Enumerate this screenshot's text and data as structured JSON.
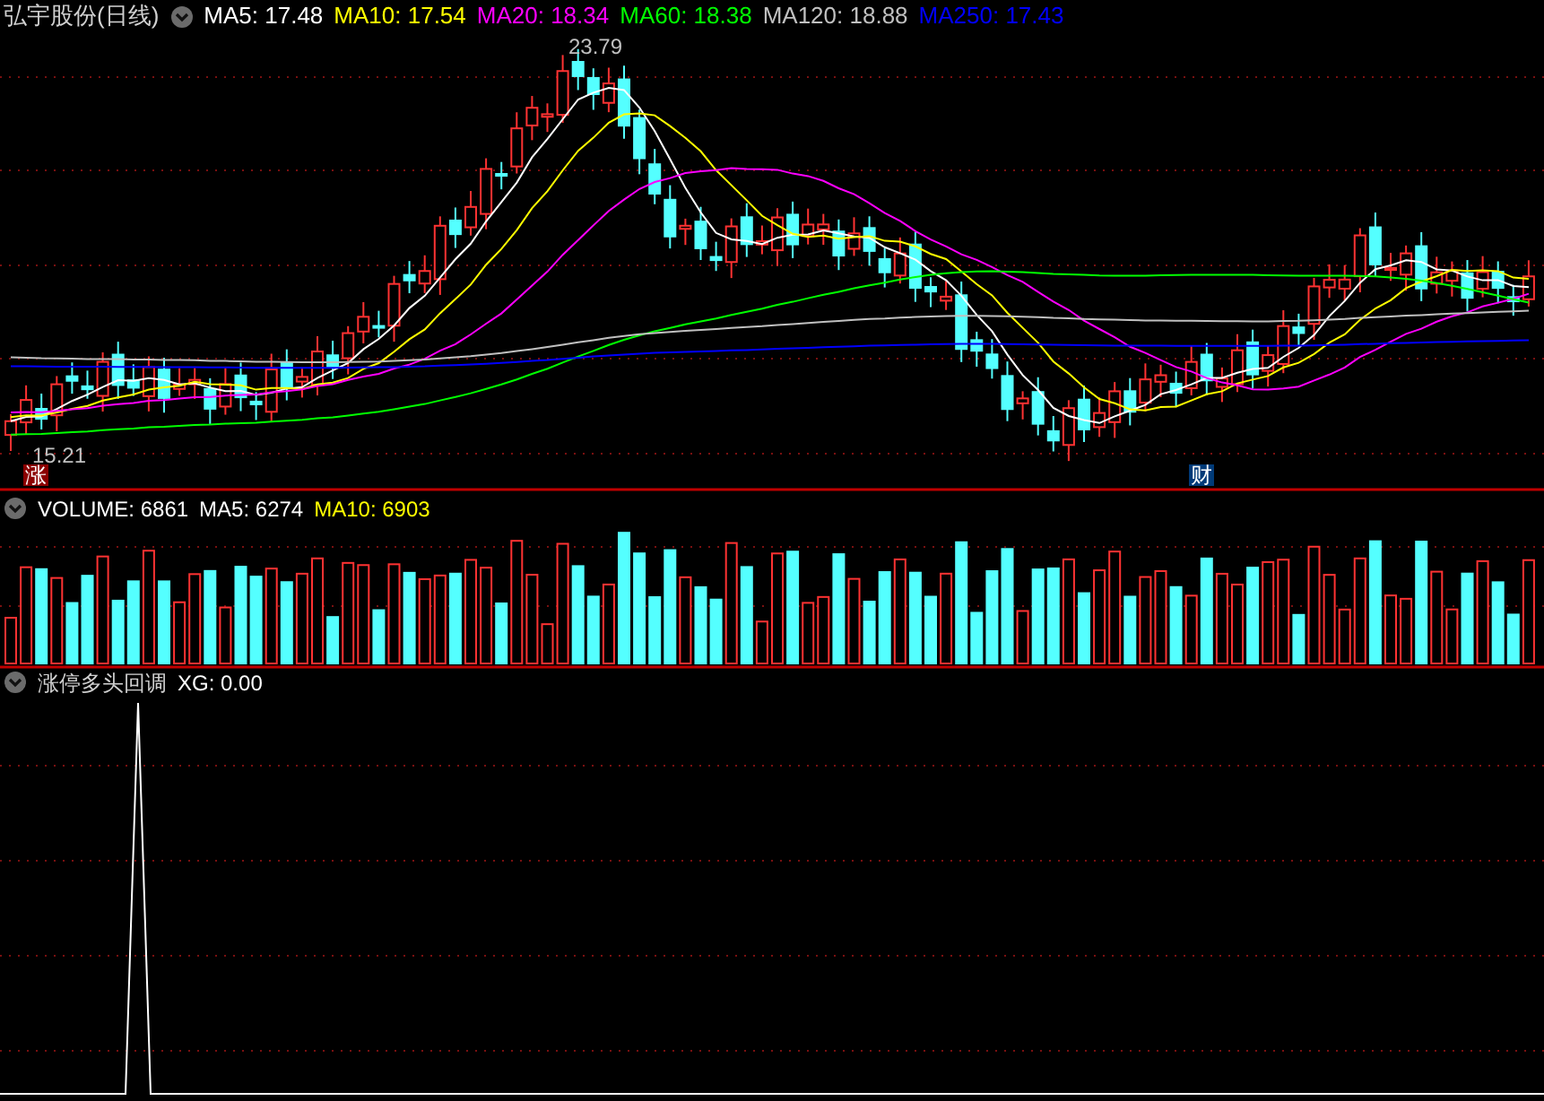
{
  "price_panel": {
    "title": "弘宇股份(日线)",
    "indicators": [
      {
        "label": "MA5: 17.48",
        "color": "#ffffff"
      },
      {
        "label": "MA10: 17.54",
        "color": "#ffff00"
      },
      {
        "label": "MA20: 18.34",
        "color": "#ff00ff"
      },
      {
        "label": "MA60: 18.38",
        "color": "#00ff00"
      },
      {
        "label": "MA120: 18.88",
        "color": "#c0c0c0"
      },
      {
        "label": "MA250: 17.43",
        "color": "#0000ff"
      }
    ],
    "high_marker": "23.79",
    "low_marker": "15.21",
    "event_badges": [
      {
        "label": "涨",
        "color": "#8b0000"
      },
      {
        "label": "财",
        "color": "#003a78"
      }
    ]
  },
  "volume_panel": {
    "indicators": [
      {
        "label": "VOLUME: 6861",
        "color": "#ffffff"
      },
      {
        "label": "MA5: 6274",
        "color": "#ffffff"
      },
      {
        "label": "MA10: 6903",
        "color": "#ffff00"
      }
    ]
  },
  "signal_panel": {
    "title": "涨停多头回调",
    "indicators": [
      {
        "label": "XG: 0.00",
        "color": "#ffffff"
      }
    ]
  }
}
